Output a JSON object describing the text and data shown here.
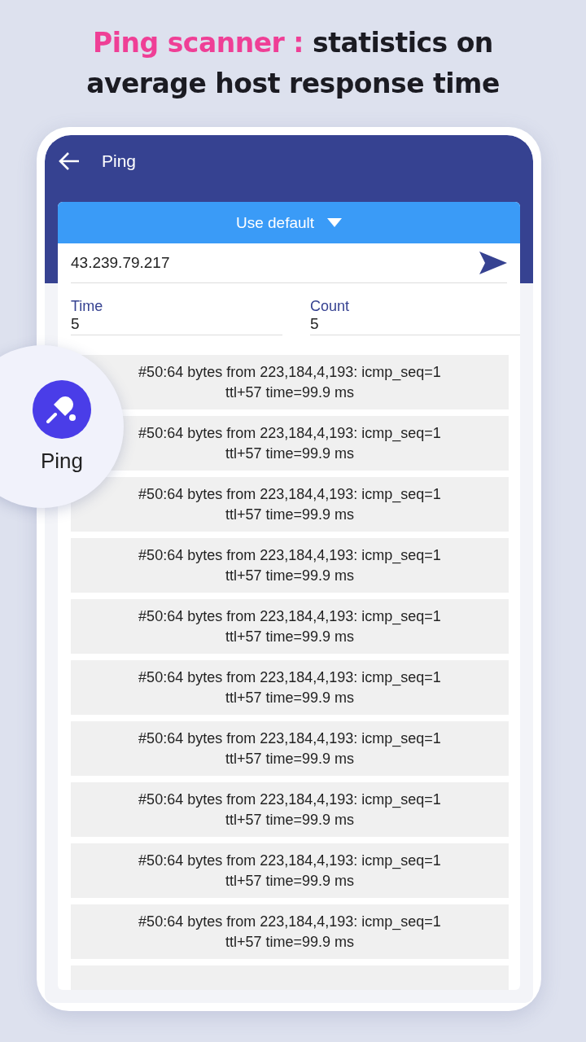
{
  "headline": "*Ping scanner :* statistics on average host response time",
  "app_bar": {
    "title": "Ping"
  },
  "preset_dropdown": {
    "label": "Use default"
  },
  "host_field": {
    "value": "43.239.79.217"
  },
  "fields": [
    {
      "label": "Time",
      "value": "5"
    },
    {
      "label": "Count",
      "value": "5"
    }
  ],
  "results": [
    "#50:64 bytes from 223,184,4,193: icmp_seq=1\nttl+57 time=99.9 ms",
    "#50:64 bytes from 223,184,4,193: icmp_seq=1\nttl+57 time=99.9 ms",
    "#50:64 bytes from 223,184,4,193: icmp_seq=1\nttl+57 time=99.9 ms",
    "#50:64 bytes from 223,184,4,193: icmp_seq=1\nttl+57 time=99.9 ms",
    "#50:64 bytes from 223,184,4,193: icmp_seq=1\nttl+57 time=99.9 ms",
    "#50:64 bytes from 223,184,4,193: icmp_seq=1\nttl+57 time=99.9 ms",
    "#50:64 bytes from 223,184,4,193: icmp_seq=1\nttl+57 time=99.9 ms",
    "#50:64 bytes from 223,184,4,193: icmp_seq=1\nttl+57 time=99.9 ms",
    "#50:64 bytes from 223,184,4,193: icmp_seq=1\nttl+57 time=99.9 ms",
    "#50:64 bytes from 223,184,4,193: icmp_seq=1\nttl+57 time=99.9 ms"
  ],
  "feature_badge": {
    "label": "Ping"
  }
}
